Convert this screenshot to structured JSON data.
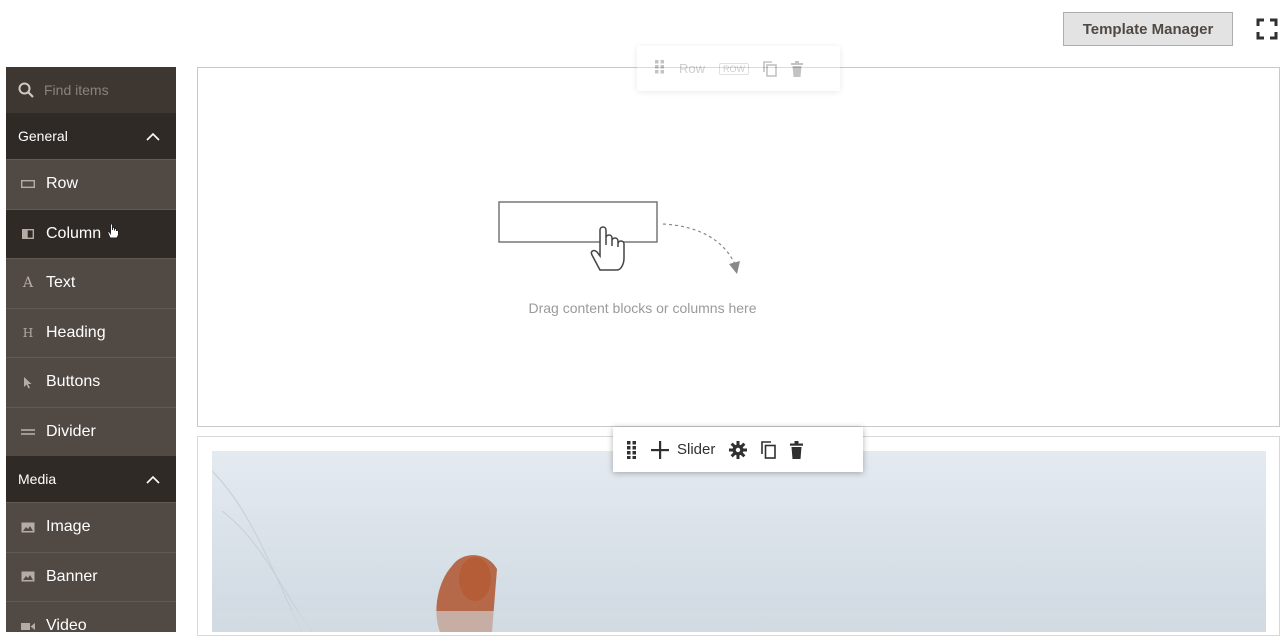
{
  "header": {
    "template_manager_label": "Template Manager",
    "fullscreen_icon": "fullscreen-icon"
  },
  "sidebar": {
    "search": {
      "placeholder": "Find items",
      "icon": "search-icon"
    },
    "groups": [
      {
        "title": "General",
        "expanded": true,
        "items": [
          {
            "label": "Row",
            "icon": "row-icon"
          },
          {
            "label": "Column",
            "icon": "column-icon",
            "active": true
          },
          {
            "label": "Text",
            "icon": "text-icon"
          },
          {
            "label": "Heading",
            "icon": "heading-icon"
          },
          {
            "label": "Buttons",
            "icon": "buttons-icon"
          },
          {
            "label": "Divider",
            "icon": "divider-icon"
          }
        ]
      },
      {
        "title": "Media",
        "expanded": true,
        "items": [
          {
            "label": "Image",
            "icon": "image-icon"
          },
          {
            "label": "Banner",
            "icon": "banner-icon"
          },
          {
            "label": "Video",
            "icon": "video-icon"
          }
        ]
      }
    ]
  },
  "stage": {
    "row_toolbar": {
      "label": "Row",
      "badge": "ROW"
    },
    "empty_hint": "Drag content blocks or columns here",
    "slider_toolbar": {
      "label": "Slider"
    }
  },
  "colors": {
    "sidebar_bg": "#514943",
    "sidebar_active": "#302a26",
    "button_bg": "#e3e3e3"
  }
}
